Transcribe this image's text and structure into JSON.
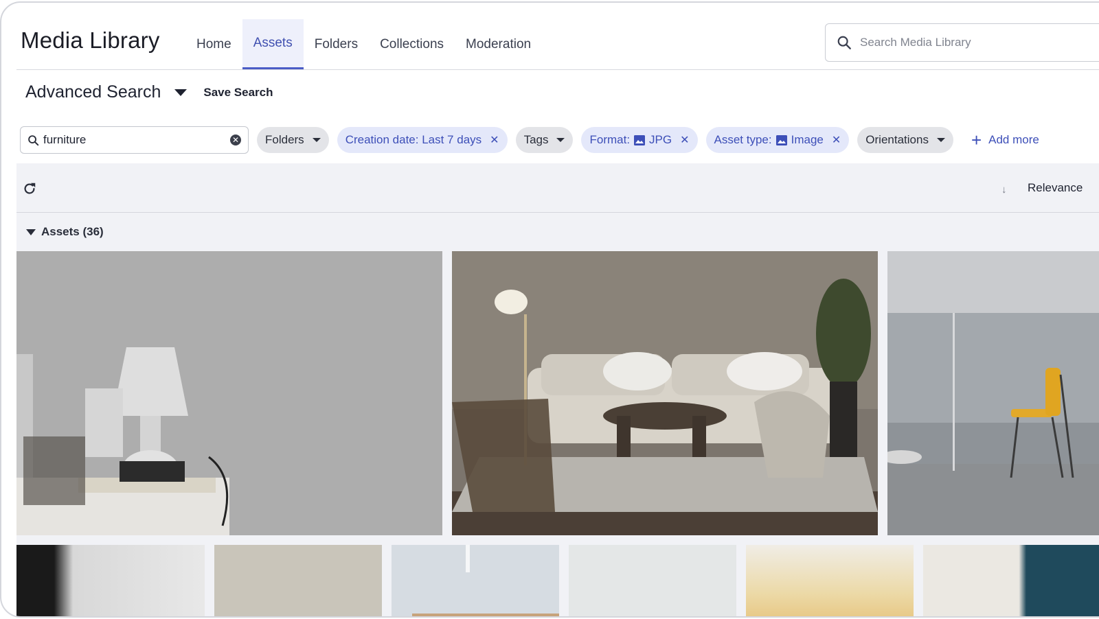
{
  "app": {
    "title": "Media Library"
  },
  "nav": {
    "tabs": [
      {
        "label": "Home"
      },
      {
        "label": "Assets",
        "active": true
      },
      {
        "label": "Folders"
      },
      {
        "label": "Collections"
      },
      {
        "label": "Moderation"
      }
    ]
  },
  "top_search": {
    "placeholder": "Search Media Library",
    "icon": "search-icon"
  },
  "advanced": {
    "title": "Advanced Search",
    "save_label": "Save Search"
  },
  "query": {
    "value": "furniture"
  },
  "filters": {
    "folders": "Folders",
    "creation_date": "Creation date: Last 7 days",
    "tags": "Tags",
    "format_prefix": "Format:",
    "format_value": "JPG",
    "asset_type_prefix": "Asset type:",
    "asset_type_value": "Image",
    "orientations": "Orientations",
    "add_more": "Add more"
  },
  "toolbar": {
    "sort_label": "Relevance",
    "sort_arrow": "↓"
  },
  "group": {
    "label": "Assets (36)"
  },
  "colors": {
    "accent": "#3d4fb8",
    "active_tab_bg": "#eef0fb",
    "results_bg": "#f1f2f6"
  }
}
